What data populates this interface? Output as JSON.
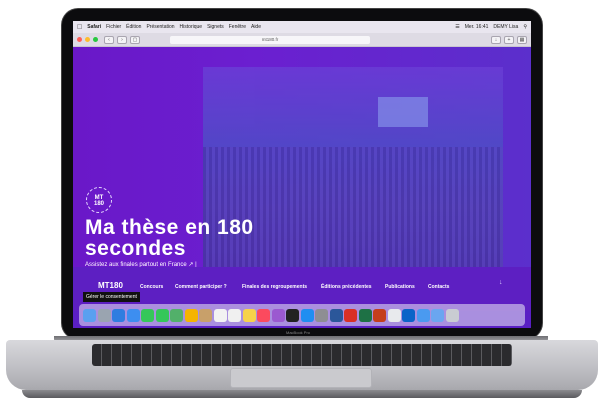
{
  "menubar": {
    "apple": "",
    "items": [
      "Safari",
      "Fichier",
      "Édition",
      "Présentation",
      "Historique",
      "Signets",
      "Fenêtre",
      "Aide"
    ],
    "right": [
      "Mer. 16:41",
      "DEMY Lisa"
    ]
  },
  "browser": {
    "url": "mt180.fr"
  },
  "hero": {
    "logo_top": "MT",
    "logo_bottom": "180",
    "title": "Ma thèse en 180 secondes",
    "link": "Assistez aux finales partout en France ↗ |"
  },
  "nav": {
    "brand": "MT180",
    "items": [
      "Concours",
      "Comment participer ?",
      "Finales des regroupements",
      "Éditions précédentes",
      "Publications",
      "Contacts"
    ],
    "chevron": "↓",
    "consent": "Gérer le consentement"
  },
  "laptop": {
    "label": "MacBook Pro"
  },
  "colors": {
    "hero_purple": "#6a18c8",
    "nav_purple": "#5d1fc2",
    "menubar": "#e9e6ef"
  },
  "dock_icons": [
    "finder-icon",
    "launchpad-icon",
    "safari-icon",
    "mail-icon",
    "facetime-icon",
    "messages-icon",
    "maps-icon",
    "photos-icon",
    "contacts-icon",
    "calendar-icon",
    "reminders-icon",
    "notes-icon",
    "music-icon",
    "podcasts-icon",
    "tv-icon",
    "appstore-icon",
    "settings-icon",
    "word-icon",
    "acrobat-icon",
    "excel-icon",
    "powerpoint-icon",
    "chrome-icon",
    "outlook-icon",
    "folder-icon",
    "downloads-icon",
    "trash-icon"
  ]
}
